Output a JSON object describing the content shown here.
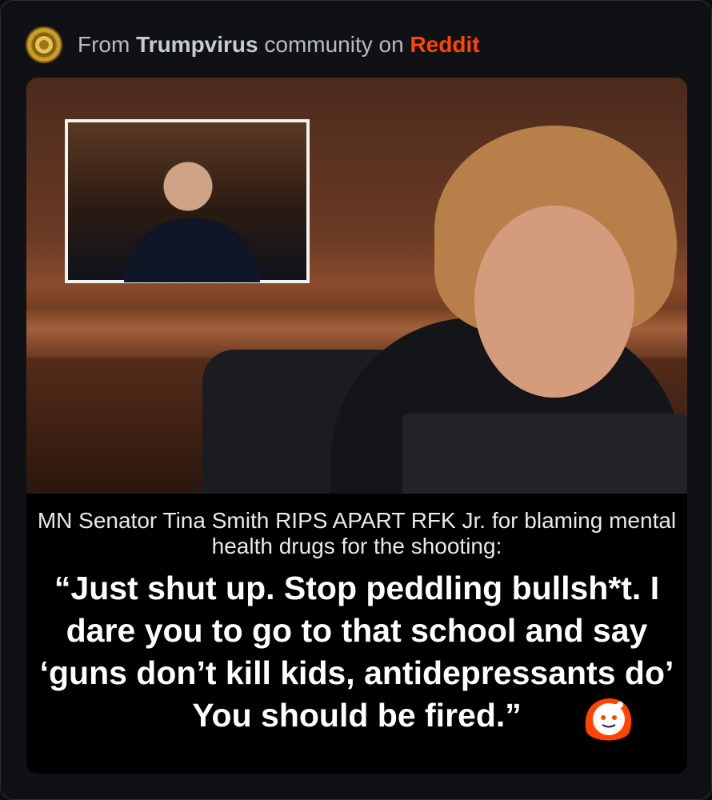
{
  "header": {
    "prefix": "From",
    "community": "Trumpvirus",
    "middle": "community on",
    "platform": "Reddit",
    "avatar_icon": "community-avatar-icon",
    "brand_color": "#ff4500"
  },
  "image": {
    "intro": "MN Senator Tina Smith RIPS APART RFK Jr. for blaming mental health drugs for the shooting:",
    "quote": "“Just shut up. Stop peddling bullsh*t. I dare you to go to that school and say ‘guns don’t kill kids, antidepressants do’ You should be fired.”",
    "reddit_badge_icon": "reddit-snoo-icon"
  }
}
